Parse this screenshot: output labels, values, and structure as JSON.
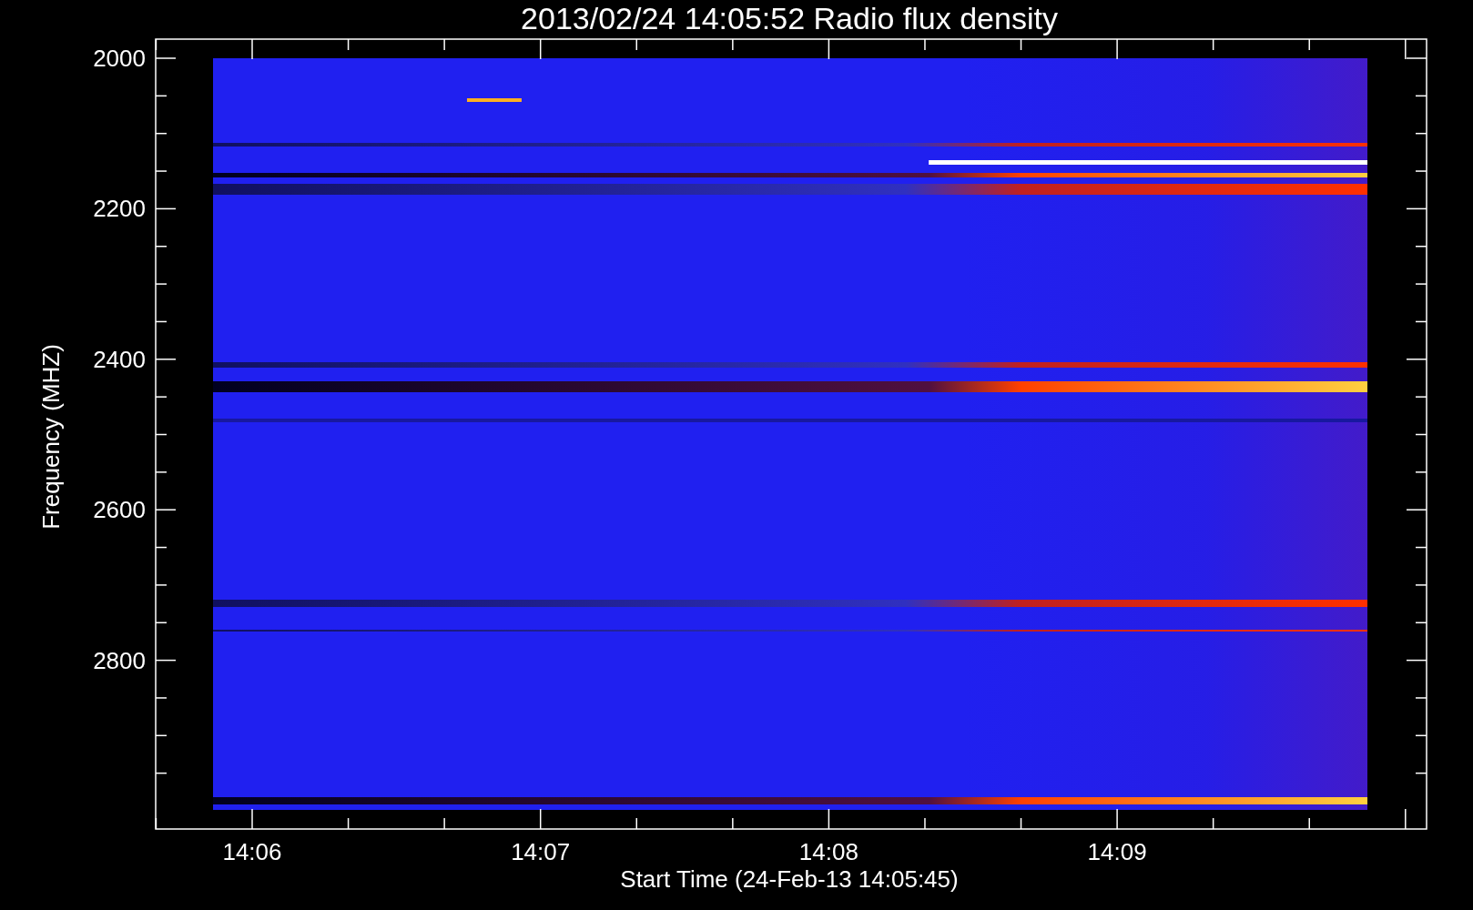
{
  "title": "2013/02/24 14:05:52 Radio flux density",
  "y_axis": {
    "label": "Frequency (MHZ)",
    "ticks": [
      "2000",
      "2200",
      "2400",
      "2600",
      "2800"
    ]
  },
  "x_axis": {
    "label": "Start Time (24-Feb-13 14:05:45)",
    "ticks": [
      "14:06",
      "14:07",
      "14:08",
      "14:09"
    ]
  }
}
